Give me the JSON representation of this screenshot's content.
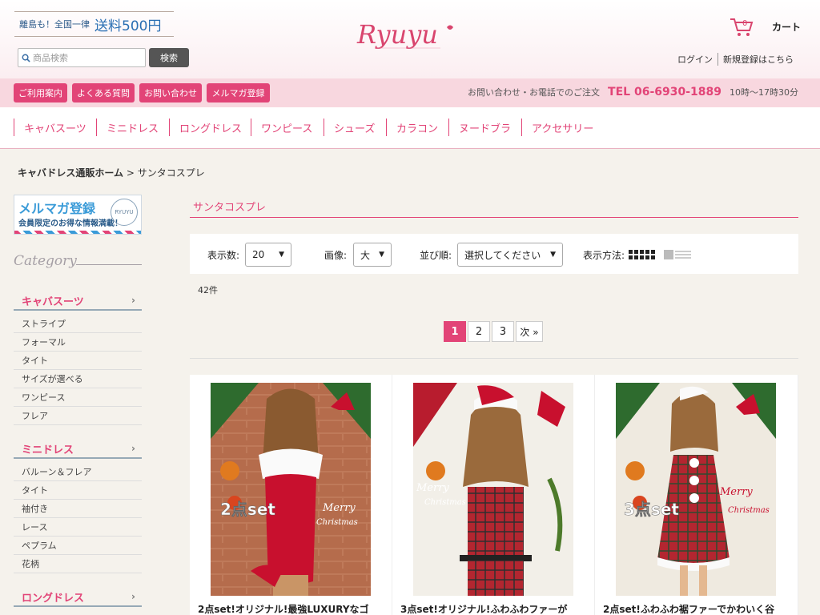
{
  "header": {
    "shipping_small": "離島も！全国一律",
    "shipping_big": "送料500円",
    "search_placeholder": "商品検索",
    "search_button": "検索",
    "logo_text": "Ryuyu",
    "cart_count": "0",
    "cart_label": "カート",
    "login": "ログイン",
    "register": "新規登録はこちら"
  },
  "pinkbar": {
    "links": [
      "ご利用案内",
      "よくある質問",
      "お問い合わせ",
      "メルマガ登録"
    ],
    "contact_text": "お問い合わせ・お電話でのご注文",
    "tel": "TEL 06-6930-1889",
    "hours": "10時〜17時30分"
  },
  "mainnav": {
    "items": [
      "キャバスーツ",
      "ミニドレス",
      "ロングドレス",
      "ワンピース",
      "シューズ",
      "カラコン",
      "ヌードブラ",
      "アクセサリー"
    ]
  },
  "breadcrumb": {
    "home": "キャバドレス通販ホーム",
    "sep": ">",
    "current": "サンタコスプレ"
  },
  "sidebar": {
    "banner_title": "メルマガ登録",
    "banner_sub": "会員限定のお得な情報満載！",
    "banner_stamp": "RYUYU",
    "category_title": "Category",
    "groups": [
      {
        "title": "キャバスーツ",
        "items": [
          "ストライプ",
          "フォーマル",
          "タイト",
          "サイズが選べる",
          "ワンピース",
          "フレア"
        ]
      },
      {
        "title": "ミニドレス",
        "items": [
          "バルーン＆フレア",
          "タイト",
          "袖付き",
          "レース",
          "ペプラム",
          "花柄"
        ]
      },
      {
        "title": "ロングドレス",
        "items": []
      }
    ]
  },
  "content": {
    "title": "サンタコスプレ",
    "filter": {
      "per_page_label": "表示数:",
      "per_page_value": "20",
      "image_label": "画像:",
      "image_value": "大",
      "sort_label": "並び順:",
      "sort_value": "選択してください",
      "view_label": "表示方法:"
    },
    "count": "42件",
    "pager": [
      "1",
      "2",
      "3",
      "次 »"
    ],
    "products": [
      {
        "name": "2点set!オリジナル!最強LUXURYなゴ",
        "badge": "2点set",
        "merry": "Merry",
        "christmas": "Christmas"
      },
      {
        "name": "3点set!オリジナル!ふわふわファーが",
        "badge": "",
        "merry": "Merry",
        "christmas": "Christmas"
      },
      {
        "name": "2点set!ふわふわ裾ファーでかわいく谷",
        "badge": "3点set",
        "merry": "Merry",
        "christmas": "Christmas"
      }
    ]
  }
}
